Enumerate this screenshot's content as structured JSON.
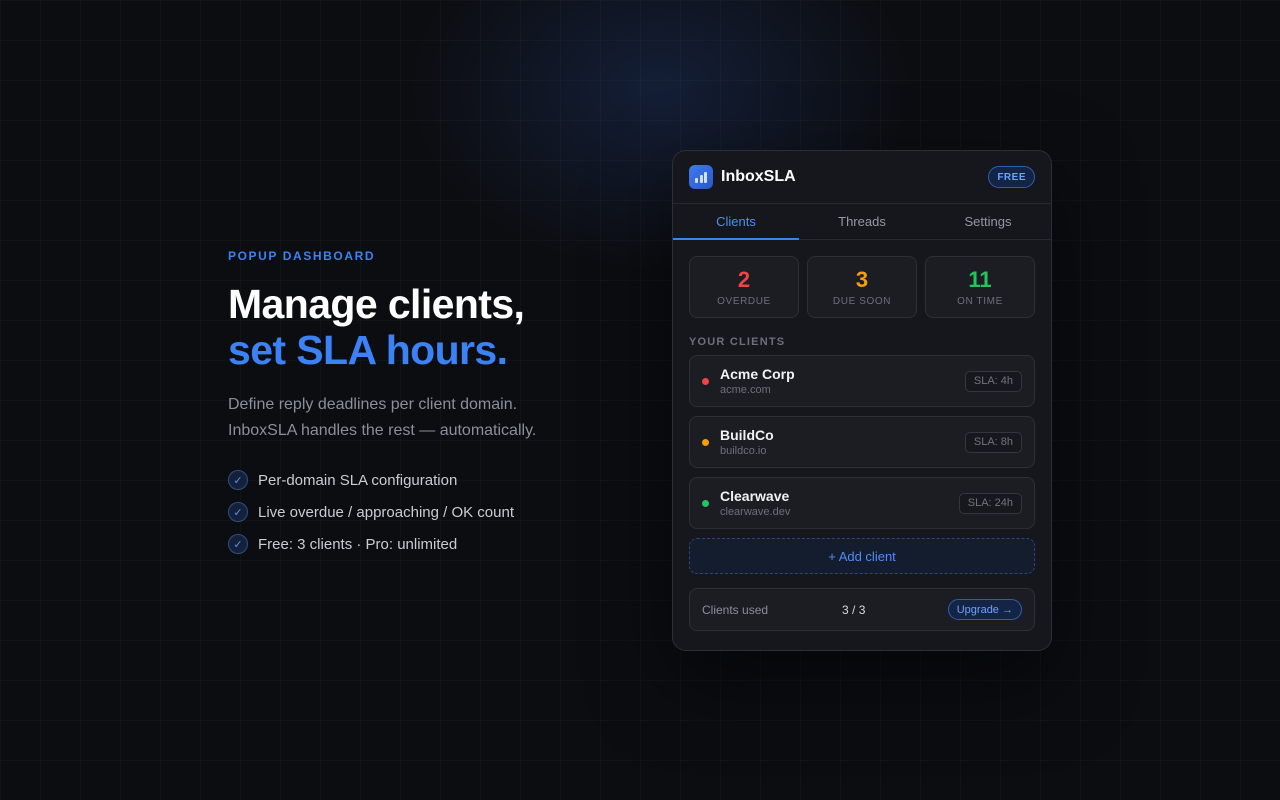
{
  "hero": {
    "eyebrow": "POPUP DASHBOARD",
    "headline_line1": "Manage clients,",
    "headline_line2": "set SLA hours.",
    "description_line1": "Define reply deadlines per client domain.",
    "description_line2": "InboxSLA handles the rest — automatically.",
    "features": [
      {
        "icon": "check-icon",
        "text": "Per-domain SLA configuration"
      },
      {
        "icon": "check-icon",
        "text": "Live overdue / approaching / OK count"
      },
      {
        "icon": "check-icon",
        "text": "Free: 3 clients · Pro: unlimited"
      }
    ],
    "check_glyph": "✓"
  },
  "popup": {
    "app_name": "InboxSLA",
    "logo_icon": "bar-chart-icon",
    "plan_badge": "FREE",
    "tabs": [
      {
        "label": "Clients",
        "active": true
      },
      {
        "label": "Threads",
        "active": false
      },
      {
        "label": "Settings",
        "active": false
      }
    ],
    "stats": [
      {
        "value": "2",
        "label": "OVERDUE",
        "color": "#ef4444"
      },
      {
        "value": "3",
        "label": "DUE SOON",
        "color": "#f59e0b"
      },
      {
        "value": "11",
        "label": "ON TIME",
        "color": "#22c55e"
      }
    ],
    "clients_section_title": "YOUR CLIENTS",
    "clients": [
      {
        "name": "Acme Corp",
        "domain": "acme.com",
        "sla": "SLA: 4h",
        "status_color": "#ef4444"
      },
      {
        "name": "BuildCo",
        "domain": "buildco.io",
        "sla": "SLA: 8h",
        "status_color": "#f59e0b"
      },
      {
        "name": "Clearwave",
        "domain": "clearwave.dev",
        "sla": "SLA: 24h",
        "status_color": "#22c55e"
      }
    ],
    "add_client_label": "+ Add client",
    "footer": {
      "label": "Clients used",
      "count": "3 / 3",
      "upgrade_label": "Upgrade →"
    }
  },
  "colors": {
    "accent": "#3b82f6",
    "background": "#0c0d11",
    "panel": "#16171c"
  }
}
